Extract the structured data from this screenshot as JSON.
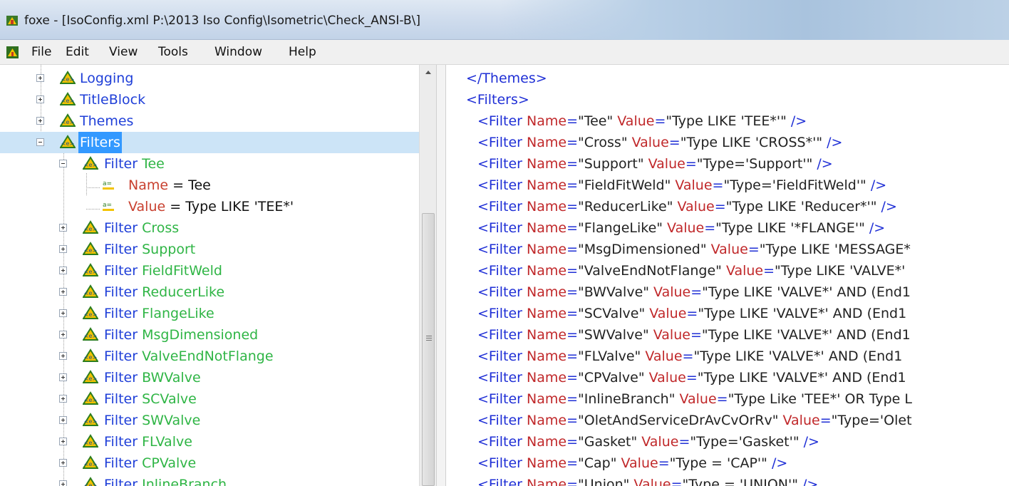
{
  "window": {
    "title": "foxe - [IsoConfig.xml  P:\\2013 Iso Config\\Isometric\\Check_ANSI-B\\]",
    "app_icon": "foxe-app-icon"
  },
  "menu": {
    "items": [
      "File",
      "Edit",
      "View",
      "Tools",
      "Window",
      "Help"
    ]
  },
  "tree": {
    "top_nodes": [
      {
        "label": "Logging",
        "state": "collapsed"
      },
      {
        "label": "TitleBlock",
        "state": "collapsed"
      },
      {
        "label": "Themes",
        "state": "collapsed"
      },
      {
        "label": "Filters",
        "state": "expanded",
        "selected": true
      }
    ],
    "expanded_filter": {
      "tag": "Filter",
      "name": "Tee",
      "attributes": [
        {
          "name": "Name",
          "eq": "=",
          "value": "Tee"
        },
        {
          "name": "Value",
          "eq": "=",
          "value": "Type LIKE 'TEE*'"
        }
      ]
    },
    "filter_children": [
      {
        "tag": "Filter",
        "name": "Cross"
      },
      {
        "tag": "Filter",
        "name": "Support"
      },
      {
        "tag": "Filter",
        "name": "FieldFitWeld"
      },
      {
        "tag": "Filter",
        "name": "ReducerLike"
      },
      {
        "tag": "Filter",
        "name": "FlangeLike"
      },
      {
        "tag": "Filter",
        "name": "MsgDimensioned"
      },
      {
        "tag": "Filter",
        "name": "ValveEndNotFlange"
      },
      {
        "tag": "Filter",
        "name": "BWValve"
      },
      {
        "tag": "Filter",
        "name": "SCValve"
      },
      {
        "tag": "Filter",
        "name": "SWValve"
      },
      {
        "tag": "Filter",
        "name": "FLValve"
      },
      {
        "tag": "Filter",
        "name": "CPValve"
      },
      {
        "tag": "Filter",
        "name": "InlineBranch"
      }
    ]
  },
  "xml": {
    "lines": [
      [
        [
          "blue",
          "</Themes>"
        ]
      ],
      [
        [
          "blue",
          "<Filters>"
        ]
      ],
      [
        [
          "blue",
          "<Filter "
        ],
        [
          "red",
          "Name"
        ],
        [
          "blue",
          "="
        ],
        [
          "dark",
          "\"Tee\" "
        ],
        [
          "red",
          "Value"
        ],
        [
          "blue",
          "="
        ],
        [
          "dark",
          "\"Type LIKE 'TEE*'\" "
        ],
        [
          "blue",
          "/>"
        ]
      ],
      [
        [
          "blue",
          "<Filter "
        ],
        [
          "red",
          "Name"
        ],
        [
          "blue",
          "="
        ],
        [
          "dark",
          "\"Cross\" "
        ],
        [
          "red",
          "Value"
        ],
        [
          "blue",
          "="
        ],
        [
          "dark",
          "\"Type LIKE 'CROSS*'\" "
        ],
        [
          "blue",
          "/>"
        ]
      ],
      [
        [
          "blue",
          "<Filter "
        ],
        [
          "red",
          "Name"
        ],
        [
          "blue",
          "="
        ],
        [
          "dark",
          "\"Support\" "
        ],
        [
          "red",
          "Value"
        ],
        [
          "blue",
          "="
        ],
        [
          "dark",
          "\"Type='Support'\" "
        ],
        [
          "blue",
          "/>"
        ]
      ],
      [
        [
          "blue",
          "<Filter "
        ],
        [
          "red",
          "Name"
        ],
        [
          "blue",
          "="
        ],
        [
          "dark",
          "\"FieldFitWeld\" "
        ],
        [
          "red",
          "Value"
        ],
        [
          "blue",
          "="
        ],
        [
          "dark",
          "\"Type='FieldFitWeld'\" "
        ],
        [
          "blue",
          "/>"
        ]
      ],
      [
        [
          "blue",
          "<Filter "
        ],
        [
          "red",
          "Name"
        ],
        [
          "blue",
          "="
        ],
        [
          "dark",
          "\"ReducerLike\" "
        ],
        [
          "red",
          "Value"
        ],
        [
          "blue",
          "="
        ],
        [
          "dark",
          "\"Type LIKE 'Reducer*'\" "
        ],
        [
          "blue",
          "/>"
        ]
      ],
      [
        [
          "blue",
          "<Filter "
        ],
        [
          "red",
          "Name"
        ],
        [
          "blue",
          "="
        ],
        [
          "dark",
          "\"FlangeLike\" "
        ],
        [
          "red",
          "Value"
        ],
        [
          "blue",
          "="
        ],
        [
          "dark",
          "\"Type LIKE '*FLANGE'\" "
        ],
        [
          "blue",
          "/>"
        ]
      ],
      [
        [
          "blue",
          "<Filter "
        ],
        [
          "red",
          "Name"
        ],
        [
          "blue",
          "="
        ],
        [
          "dark",
          "\"MsgDimensioned\" "
        ],
        [
          "red",
          "Value"
        ],
        [
          "blue",
          "="
        ],
        [
          "dark",
          "\"Type LIKE 'MESSAGE*"
        ]
      ],
      [
        [
          "blue",
          "<Filter "
        ],
        [
          "red",
          "Name"
        ],
        [
          "blue",
          "="
        ],
        [
          "dark",
          "\"ValveEndNotFlange\" "
        ],
        [
          "red",
          "Value"
        ],
        [
          "blue",
          "="
        ],
        [
          "dark",
          "\"Type LIKE 'VALVE*'"
        ]
      ],
      [
        [
          "blue",
          "<Filter "
        ],
        [
          "red",
          "Name"
        ],
        [
          "blue",
          "="
        ],
        [
          "dark",
          "\"BWValve\" "
        ],
        [
          "red",
          "Value"
        ],
        [
          "blue",
          "="
        ],
        [
          "dark",
          "\"Type LIKE 'VALVE*' AND (End1"
        ]
      ],
      [
        [
          "blue",
          "<Filter "
        ],
        [
          "red",
          "Name"
        ],
        [
          "blue",
          "="
        ],
        [
          "dark",
          "\"SCValve\" "
        ],
        [
          "red",
          "Value"
        ],
        [
          "blue",
          "="
        ],
        [
          "dark",
          "\"Type LIKE 'VALVE*' AND (End1"
        ]
      ],
      [
        [
          "blue",
          "<Filter "
        ],
        [
          "red",
          "Name"
        ],
        [
          "blue",
          "="
        ],
        [
          "dark",
          "\"SWValve\" "
        ],
        [
          "red",
          "Value"
        ],
        [
          "blue",
          "="
        ],
        [
          "dark",
          "\"Type LIKE 'VALVE*' AND (End1"
        ]
      ],
      [
        [
          "blue",
          "<Filter "
        ],
        [
          "red",
          "Name"
        ],
        [
          "blue",
          "="
        ],
        [
          "dark",
          "\"FLValve\" "
        ],
        [
          "red",
          "Value"
        ],
        [
          "blue",
          "="
        ],
        [
          "dark",
          "\"Type LIKE 'VALVE*' AND (End1"
        ]
      ],
      [
        [
          "blue",
          "<Filter "
        ],
        [
          "red",
          "Name"
        ],
        [
          "blue",
          "="
        ],
        [
          "dark",
          "\"CPValve\" "
        ],
        [
          "red",
          "Value"
        ],
        [
          "blue",
          "="
        ],
        [
          "dark",
          "\"Type LIKE 'VALVE*' AND (End1"
        ]
      ],
      [
        [
          "blue",
          "<Filter "
        ],
        [
          "red",
          "Name"
        ],
        [
          "blue",
          "="
        ],
        [
          "dark",
          "\"InlineBranch\" "
        ],
        [
          "red",
          "Value"
        ],
        [
          "blue",
          "="
        ],
        [
          "dark",
          "\"Type Like 'TEE*' OR Type L"
        ]
      ],
      [
        [
          "blue",
          "<Filter "
        ],
        [
          "red",
          "Name"
        ],
        [
          "blue",
          "="
        ],
        [
          "dark",
          "\"OletAndServiceDrAvCvOrRv\" "
        ],
        [
          "red",
          "Value"
        ],
        [
          "blue",
          "="
        ],
        [
          "dark",
          "\"Type='Olet"
        ]
      ],
      [
        [
          "blue",
          "<Filter "
        ],
        [
          "red",
          "Name"
        ],
        [
          "blue",
          "="
        ],
        [
          "dark",
          "\"Gasket\" "
        ],
        [
          "red",
          "Value"
        ],
        [
          "blue",
          "="
        ],
        [
          "dark",
          "\"Type='Gasket'\" "
        ],
        [
          "blue",
          "/>"
        ]
      ],
      [
        [
          "blue",
          "<Filter "
        ],
        [
          "red",
          "Name"
        ],
        [
          "blue",
          "="
        ],
        [
          "dark",
          "\"Cap\" "
        ],
        [
          "red",
          "Value"
        ],
        [
          "blue",
          "="
        ],
        [
          "dark",
          "\"Type = 'CAP'\" "
        ],
        [
          "blue",
          "/>"
        ]
      ],
      [
        [
          "blue",
          "<Filter "
        ],
        [
          "red",
          "Name"
        ],
        [
          "blue",
          "="
        ],
        [
          "dark",
          "\"Union\" "
        ],
        [
          "red",
          "Value"
        ],
        [
          "blue",
          "="
        ],
        [
          "dark",
          "\"Type = 'UNION'\" "
        ],
        [
          "blue",
          "/>"
        ]
      ]
    ]
  },
  "colors": {
    "tree_blue": "#1f3fd8",
    "tree_green": "#2fb545",
    "attr_red": "#c8402f",
    "selection": "#3399ff",
    "xml_blue": "#1f2fd6",
    "xml_red": "#c0282a"
  }
}
